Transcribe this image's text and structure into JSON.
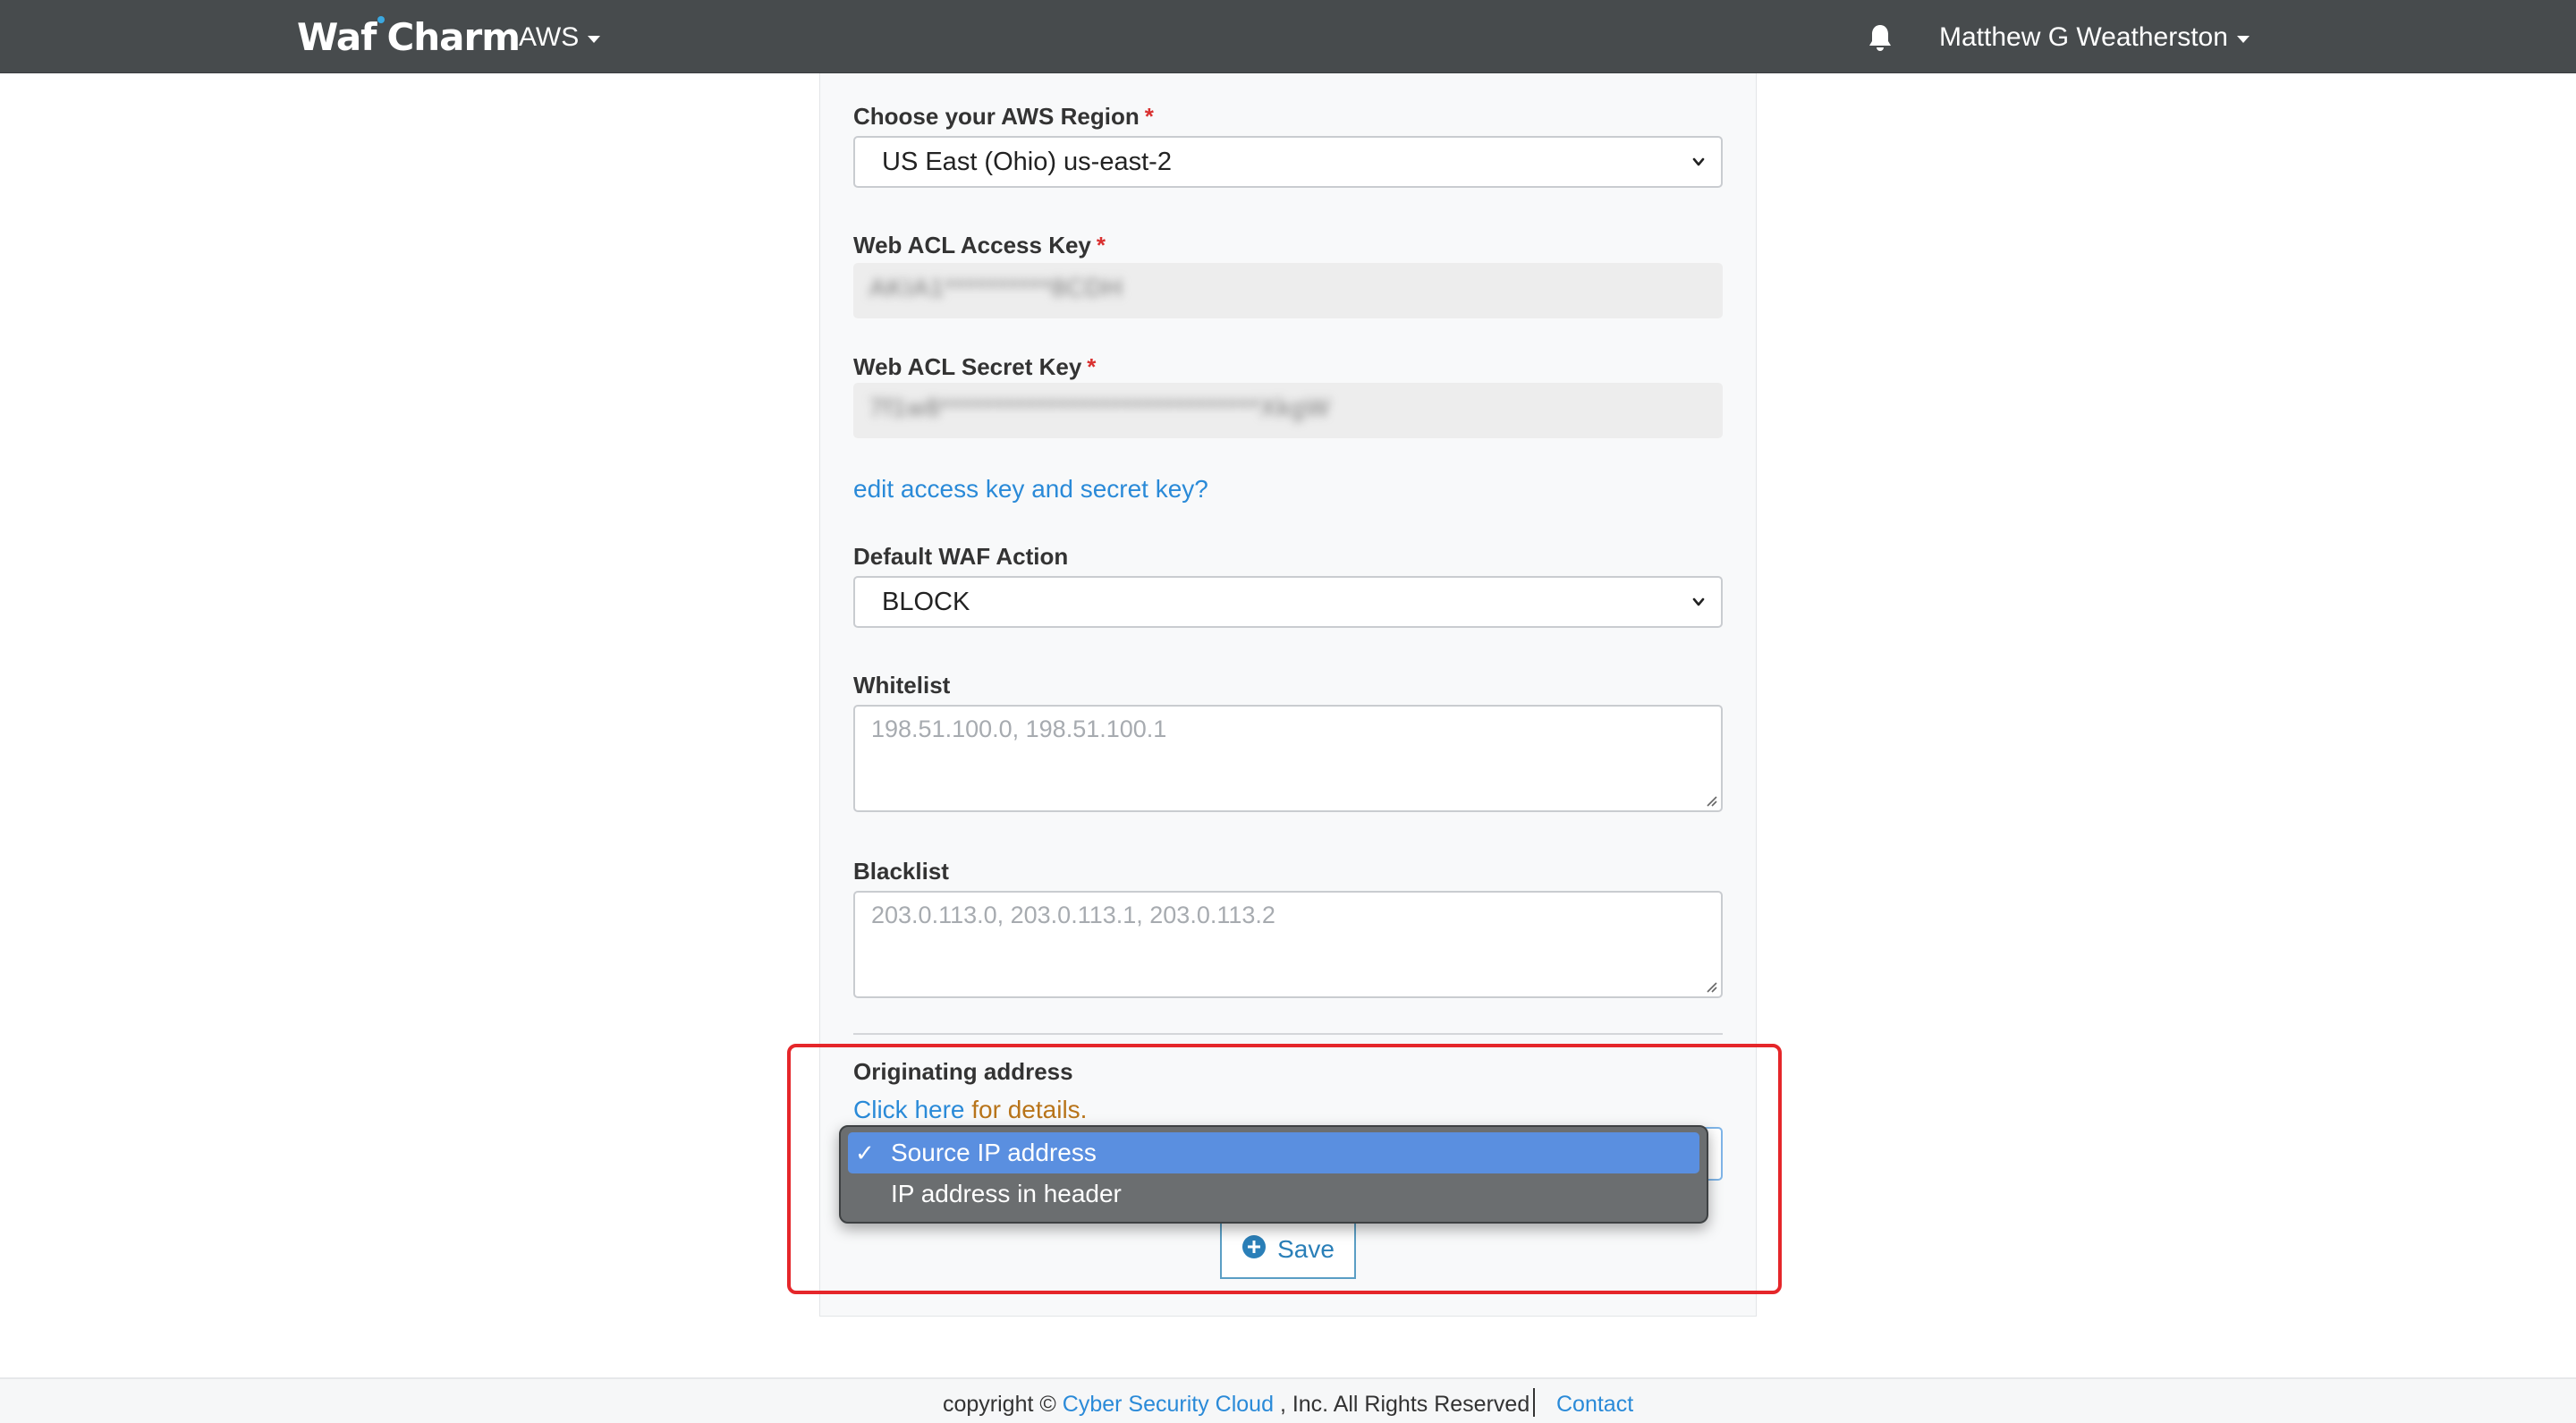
{
  "navbar": {
    "logo_part1": "Waf",
    "logo_part2": "Charm",
    "service_menu": "AWS",
    "user_name": "Matthew G Weatherston",
    "icons": {
      "notifications": "bell-icon",
      "menu_caret": "caret-down-icon"
    }
  },
  "form": {
    "region": {
      "label": "Choose your AWS Region",
      "required_mark": "*",
      "value": "US East (Ohio) us-east-2"
    },
    "access_key": {
      "label": "Web ACL Access Key",
      "required_mark": "*",
      "value": "AKIA1**********8CDH"
    },
    "secret_key": {
      "label": "Web ACL Secret Key",
      "required_mark": "*",
      "value": "7f1w8******************************XkgW"
    },
    "edit_keys_link": "edit access key and secret key?",
    "default_action": {
      "label": "Default WAF Action",
      "value": "BLOCK"
    },
    "whitelist": {
      "label": "Whitelist",
      "placeholder": "198.51.100.0, 198.51.100.1"
    },
    "blacklist": {
      "label": "Blacklist",
      "placeholder": "203.0.113.0, 203.0.113.1, 203.0.113.2"
    },
    "originating_address": {
      "label": "Originating address",
      "details_link": "Click here",
      "details_suffix": "for details.",
      "options": [
        {
          "label": "Source IP address",
          "selected": true,
          "check": "✓"
        },
        {
          "label": "IP address in header",
          "selected": false
        }
      ]
    },
    "save_button": "Save"
  },
  "footer": {
    "copyright_prefix": "copyright ©",
    "company_link": "Cyber Security Cloud",
    "copyright_suffix": ", Inc. All Rights Reserved",
    "contact_link": "Contact"
  },
  "colors": {
    "navbar_bg": "#474b4d",
    "link": "#2a8ad8",
    "required": "#d9302f",
    "highlight": "#e5262a",
    "selected_option": "#5a8fe0"
  }
}
